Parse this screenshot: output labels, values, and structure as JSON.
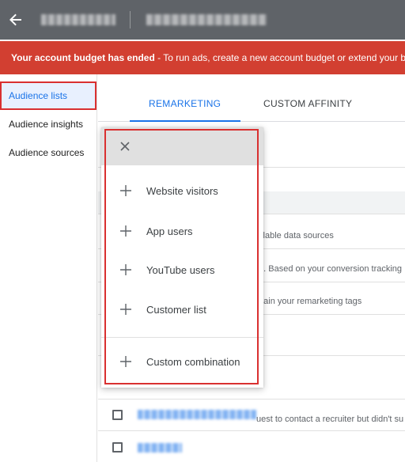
{
  "appbar": {
    "back_icon": "arrow-left-icon",
    "account_name": "",
    "page_title": ""
  },
  "banner": {
    "bold_text": "Your account budget has ended",
    "rest_text": " - To run ads, create a new account budget or extend your budget"
  },
  "sidebar": {
    "items": [
      {
        "label": "Audience lists",
        "active": true
      },
      {
        "label": "Audience insights",
        "active": false
      },
      {
        "label": "Audience sources",
        "active": false
      }
    ]
  },
  "tabs": [
    {
      "label": "REMARKETING",
      "active": true
    },
    {
      "label": "CUSTOM AFFINITY",
      "active": false
    }
  ],
  "background_fragments": {
    "f1": "ailable data sources",
    "f2": "te. Based on your conversion tracking",
    "f3": "ntain your remarketing tags",
    "f4": "uest to contact a recruiter but didn't su"
  },
  "menu": {
    "close_icon": "close-icon",
    "items": [
      {
        "label": "Website visitors",
        "icon": "plus-icon"
      },
      {
        "label": "App users",
        "icon": "plus-icon"
      },
      {
        "label": "YouTube users",
        "icon": "plus-icon"
      },
      {
        "label": "Customer list",
        "icon": "plus-icon"
      },
      {
        "label": "Custom combination",
        "icon": "plus-icon"
      }
    ]
  },
  "colors": {
    "appbar": "#5f6368",
    "banner": "#d23f31",
    "accent": "#1a73e8",
    "highlight_outline": "#d93030"
  }
}
